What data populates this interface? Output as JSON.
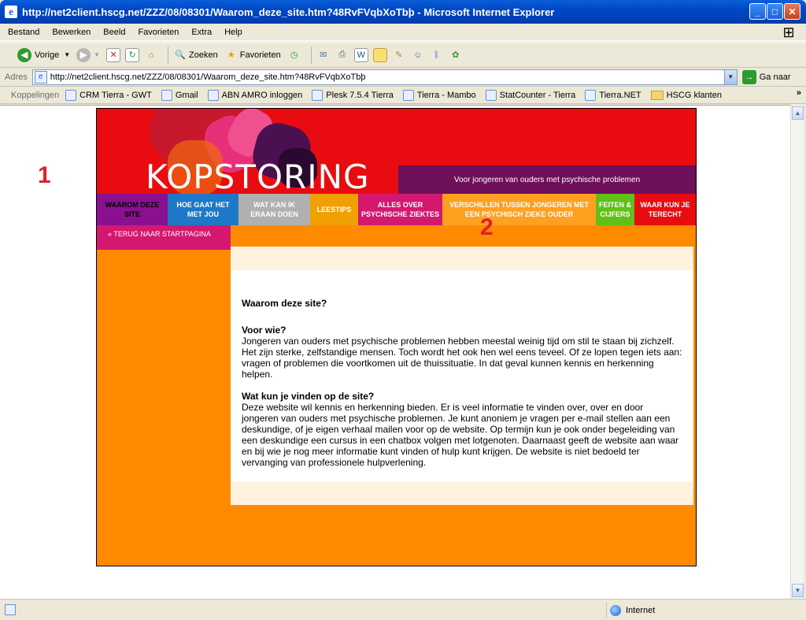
{
  "window": {
    "title": "http://net2client.hscg.net/ZZZ/08/08301/Waarom_deze_site.htm?48RvFVqbXoTbþ - Microsoft Internet Explorer"
  },
  "menu": [
    "Bestand",
    "Bewerken",
    "Beeld",
    "Favorieten",
    "Extra",
    "Help"
  ],
  "toolbar": {
    "back_label": "Vorige",
    "search_label": "Zoeken",
    "favorites_label": "Favorieten"
  },
  "address": {
    "label": "Adres",
    "url": "http://net2client.hscg.net/ZZZ/08/08301/Waarom_deze_site.htm?48RvFVqbXoTbþ",
    "go_label": "Ga naar"
  },
  "links": {
    "label": "Koppelingen",
    "items": [
      "CRM Tierra - GWT",
      "Gmail",
      "ABN AMRO inloggen",
      "Plesk 7.5.4 Tierra",
      "Tierra - Mambo",
      "StatCounter - Tierra",
      "Tierra.NET",
      "HSCG klanten"
    ]
  },
  "annotations": [
    "1",
    "2"
  ],
  "site": {
    "logo": "KOPSTORING",
    "tagline": "Voor jongeren van ouders met psychische problemen",
    "nav": [
      {
        "label": "WAAROM DEZE SITE",
        "color": "#8A1090",
        "text_color": "#000000"
      },
      {
        "label": "HOE GAAT HET MET JOU",
        "color": "#1E78C8",
        "text_color": "#FFFFFF"
      },
      {
        "label": "WAT KAN IK ERAAN DOEN",
        "color": "#B0B0B0",
        "text_color": "#FFFFFF"
      },
      {
        "label": "LEESTIPS",
        "color": "#F0A000",
        "text_color": "#FFFFFF"
      },
      {
        "label": "ALLES OVER PSYCHISCHE ZIEKTES",
        "color": "#D41870",
        "text_color": "#FFFFFF"
      },
      {
        "label": "VERSCHILLEN TUSSEN JONGEREN MET EEN PSYCHISCH ZIEKE OUDER",
        "color": "#FFA020",
        "text_color": "#FFFFFF"
      },
      {
        "label": "FEITEN & CIJFERS",
        "color": "#60C018",
        "text_color": "#FFFFFF"
      },
      {
        "label": "WAAR KUN JE TERECHT",
        "color": "#E80C10",
        "text_color": "#FFFFFF"
      }
    ],
    "back_link": "« TERUG NAAR STARTPAGINA",
    "content": {
      "title": "Waarom deze site?",
      "section1_heading": "Voor wie?",
      "section1_text": "Jongeren van ouders met psychische problemen hebben meestal weinig tijd om stil te staan bij zichzelf. Het zijn sterke, zelfstandige mensen. Toch wordt het ook hen wel eens teveel. Of ze lopen tegen iets aan: vragen of problemen die voortkomen uit de thuissituatie. In dat geval kunnen kennis en herkenning helpen.",
      "section2_heading": "Wat kun je vinden op de site?",
      "section2_text": "Deze website wil kennis en herkenning bieden. Er is veel informatie te vinden over, over en door jongeren van ouders met psychische problemen. Je kunt anoniem je vragen per e-mail stellen aan een deskundige, of je eigen verhaal mailen voor op de website. Op termijn kun je ook onder begeleiding van een deskundige een cursus in een chatbox volgen met lotgenoten. Daarnaast geeft de website aan waar en bij wie je nog meer informatie kunt vinden of hulp kunt krijgen. De website is niet bedoeld ter vervanging van professionele hulpverlening."
    }
  },
  "status": {
    "zone": "Internet"
  }
}
